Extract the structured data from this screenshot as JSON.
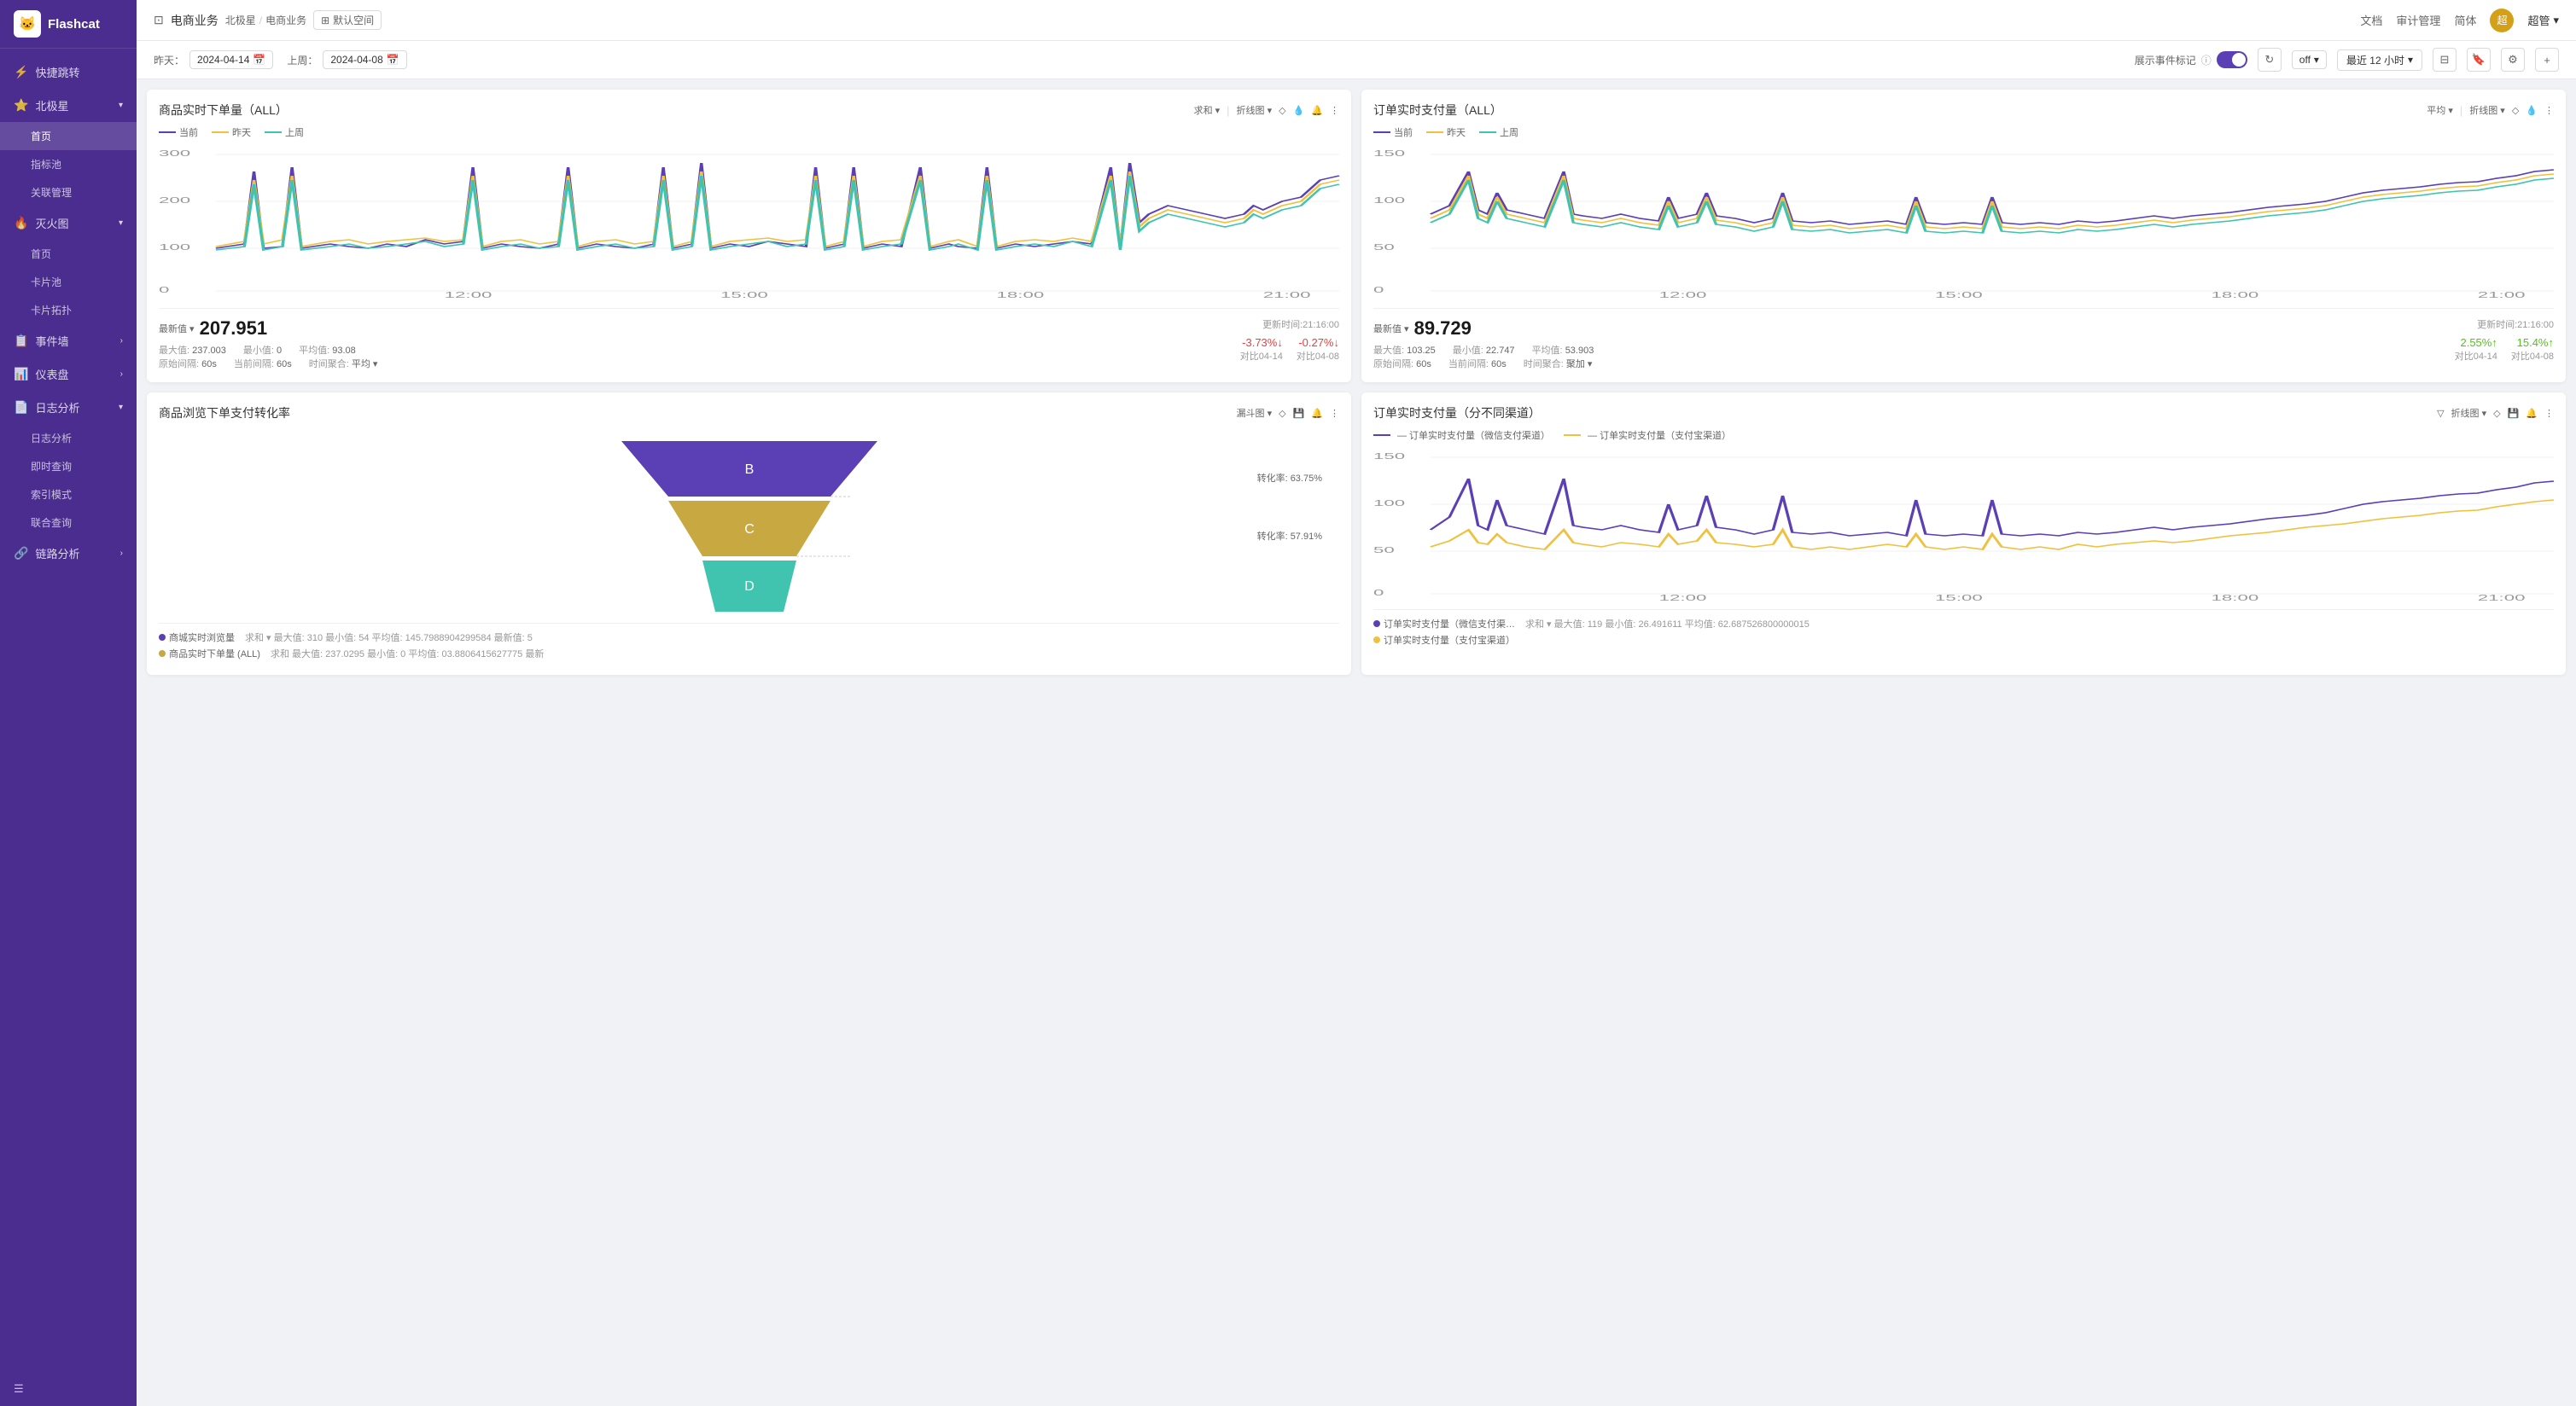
{
  "sidebar": {
    "logo": "Flashcat",
    "logo_emoji": "🐱",
    "nav_items": [
      {
        "id": "quick-jump",
        "label": "快捷跳转",
        "icon": "⚡",
        "has_arrow": false,
        "active": false
      },
      {
        "id": "north-star",
        "label": "北极星",
        "icon": "⭐",
        "has_arrow": true,
        "active": false
      },
      {
        "id": "home",
        "label": "首页",
        "icon": "",
        "active": true,
        "indent": true
      },
      {
        "id": "metrics",
        "label": "指标池",
        "icon": "",
        "active": false,
        "indent": true
      },
      {
        "id": "relation",
        "label": "关联管理",
        "icon": "",
        "active": false,
        "indent": true
      },
      {
        "id": "heatmap",
        "label": "灭火图",
        "icon": "🔥",
        "has_arrow": true,
        "active": false
      },
      {
        "id": "heatmap-home",
        "label": "首页",
        "icon": "",
        "active": false,
        "indent": true
      },
      {
        "id": "card-pool",
        "label": "卡片池",
        "icon": "",
        "active": false,
        "indent": true
      },
      {
        "id": "card-topo",
        "label": "卡片拓扑",
        "icon": "",
        "active": false,
        "indent": true
      },
      {
        "id": "event-wall",
        "label": "事件墙",
        "icon": "📋",
        "has_arrow": true,
        "active": false
      },
      {
        "id": "dashboard",
        "label": "仪表盘",
        "icon": "📊",
        "has_arrow": true,
        "active": false
      },
      {
        "id": "log-analysis",
        "label": "日志分析",
        "icon": "📄",
        "has_arrow": true,
        "active": false
      },
      {
        "id": "log-analysis-sub",
        "label": "日志分析",
        "active": false,
        "indent": true
      },
      {
        "id": "realtime-query",
        "label": "即时查询",
        "active": false,
        "indent": true
      },
      {
        "id": "index-mode",
        "label": "索引模式",
        "active": false,
        "indent": true
      },
      {
        "id": "union-query",
        "label": "联合查询",
        "active": false,
        "indent": true
      },
      {
        "id": "link-analysis",
        "label": "链路分析",
        "icon": "🔗",
        "has_arrow": true,
        "active": false
      }
    ],
    "bottom_icon": "☰"
  },
  "topbar": {
    "page_icon": "⊡",
    "page_title": "电商业务",
    "breadcrumb": [
      "北极星",
      "电商业务"
    ],
    "space_label": "默认空间",
    "space_icon": "⊞",
    "links": [
      "文档",
      "审计管理",
      "简体"
    ],
    "user_avatar_text": "超",
    "user_name": "超管"
  },
  "filter_bar": {
    "yesterday_label": "昨天：",
    "yesterday_date": "2024-04-14",
    "last_week_label": "上周：",
    "last_week_date": "2024-04-08",
    "event_mark_label": "展示事件标记",
    "toggle_state": "on",
    "off_label": "off",
    "time_range_label": "最近 12 小时",
    "buttons": [
      "columns-icon",
      "bookmark-icon",
      "settings-icon",
      "add-icon"
    ]
  },
  "charts": {
    "chart1": {
      "title": "商品实时下单量（ALL）",
      "controls": [
        "求和",
        "折线图",
        "◇",
        "💧",
        "🔔",
        "⋮"
      ],
      "legend": [
        {
          "label": "当前",
          "color": "#5b3fb5"
        },
        {
          "label": "昨天",
          "color": "#f0c040"
        },
        {
          "label": "上周",
          "color": "#40c4b0"
        }
      ],
      "y_labels": [
        "300",
        "200",
        "100",
        "0"
      ],
      "x_labels": [
        "12:00",
        "15:00",
        "18:00",
        "21:00"
      ],
      "metric_label": "最新值",
      "metric_value": "207.951",
      "update_time": "更新时间:21:16:00",
      "stats": {
        "max_label": "最大值：",
        "max_val": "237.003",
        "min_label": "最小值：",
        "min_val": "0",
        "avg_label": "平均值：",
        "avg_val": "93.08"
      },
      "intervals": {
        "orig_label": "原始间隔：",
        "orig_val": "60s",
        "curr_label": "当前间隔：",
        "curr_val": "60s",
        "agg_label": "时间聚合：",
        "agg_val": "平均"
      },
      "changes": [
        {
          "value": "-3.73%↓",
          "type": "down",
          "label": "对比04-14"
        },
        {
          "value": "-0.27%↓",
          "type": "down",
          "label": "对比04-08"
        }
      ]
    },
    "chart2": {
      "title": "订单实时支付量（ALL）",
      "controls": [
        "平均",
        "折线图",
        "◇",
        "💧",
        "⋮"
      ],
      "legend": [
        {
          "label": "当前",
          "color": "#5b3fb5"
        },
        {
          "label": "昨天",
          "color": "#f0c040"
        },
        {
          "label": "上周",
          "color": "#40c4b0"
        }
      ],
      "y_labels": [
        "150",
        "100",
        "50",
        "0"
      ],
      "x_labels": [
        "12:00",
        "15:00",
        "18:00",
        "21:00"
      ],
      "metric_label": "最新值",
      "metric_value": "89.729",
      "update_time": "更新时间:21:16:00",
      "stats": {
        "max_label": "最大值：",
        "max_val": "103.25",
        "min_label": "最小值：",
        "min_val": "22.747",
        "avg_label": "平均值：",
        "avg_val": "53.903"
      },
      "intervals": {
        "orig_label": "原始间隔：",
        "orig_val": "60s",
        "curr_label": "当前间隔：",
        "curr_val": "60s",
        "agg_label": "时间聚合：",
        "agg_val": "聚加"
      },
      "changes": [
        {
          "value": "2.55%↑",
          "type": "up",
          "label": "对比04-14"
        },
        {
          "value": "15.4%↑",
          "type": "up",
          "label": "对比04-08"
        }
      ]
    },
    "chart3": {
      "title": "商品浏览下单支付转化率",
      "controls": [
        "漏斗图",
        "◇",
        "💾",
        "🔔",
        "⋮"
      ],
      "funnel": {
        "layers": [
          {
            "label": "B",
            "color": "#5b3fb5",
            "width_pct": 100
          },
          {
            "label": "C",
            "color": "#c8a840",
            "width_pct": 63.75
          },
          {
            "label": "D",
            "color": "#40c4b0",
            "width_pct": 57.91
          }
        ],
        "rates": [
          "转化率: 63.75%",
          "转化率: 57.91%"
        ]
      },
      "bottom_stats": [
        {
          "color": "#5b3fb5",
          "label": "商城实时浏览量",
          "stats": "求和 ∨  最大值: 310  最小值: 54  平均值: 145.7988904299584  最新值: 5"
        },
        {
          "color": "#c8a840",
          "label": "商品实时下单量 (ALL)",
          "stats": "求和  最大值: 237.0295  最小值: 0  平均值: 03.8806415627775  最新"
        }
      ]
    },
    "chart4": {
      "title": "订单实时支付量（分不同渠道）",
      "controls": [
        "▽",
        "折线图",
        "◇",
        "💾",
        "🔔",
        "⋮"
      ],
      "legend": [
        {
          "label": "订单实时支付量（微信支付渠道）",
          "color": "#5b3fb5",
          "style": "dashed"
        },
        {
          "label": "订单实时支付量（支付宝渠道）",
          "color": "#f0c040",
          "style": "dashed"
        }
      ],
      "y_labels": [
        "150",
        "100",
        "50",
        "0"
      ],
      "x_labels": [
        "12:00",
        "15:00",
        "18:00",
        "21:00"
      ],
      "bottom_stats": [
        {
          "color": "#5b3fb5",
          "label": "订单实时支付量（微信支付渠…",
          "stats": "求和 ∨  最大值: 119  最小值: 26.491611  平均值: 62.687526800000015"
        },
        {
          "color": "#f0c040",
          "label": "订单实时支付量（支付宝渠道）",
          "stats": ""
        }
      ]
    }
  }
}
